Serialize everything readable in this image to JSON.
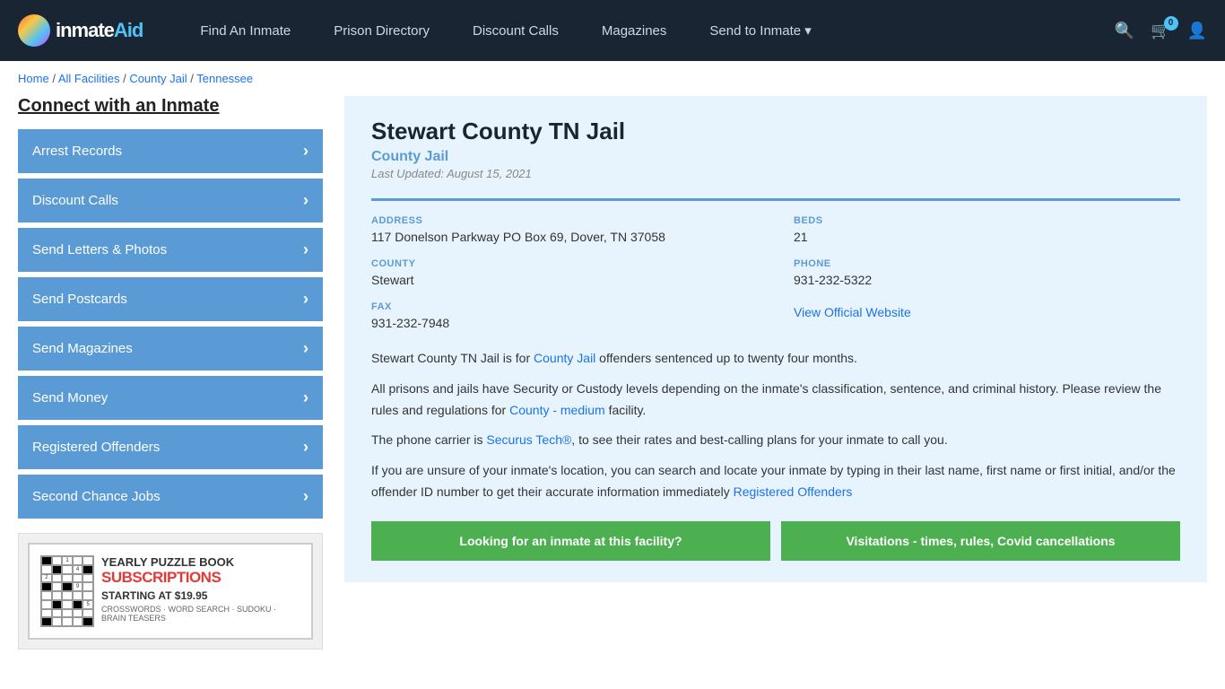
{
  "site": {
    "logo_text": "inmateAid",
    "logo_text_highlight": "Aid"
  },
  "nav": {
    "find_inmate": "Find An Inmate",
    "prison_directory": "Prison Directory",
    "discount_calls": "Discount Calls",
    "magazines": "Magazines",
    "send_to_inmate": "Send to Inmate ▾",
    "cart_count": "0"
  },
  "breadcrumb": {
    "home": "Home",
    "all_facilities": "All Facilities",
    "county_jail": "County Jail",
    "state": "Tennessee"
  },
  "sidebar": {
    "title": "Connect with an Inmate",
    "items": [
      {
        "label": "Arrest Records"
      },
      {
        "label": "Discount Calls"
      },
      {
        "label": "Send Letters & Photos"
      },
      {
        "label": "Send Postcards"
      },
      {
        "label": "Send Magazines"
      },
      {
        "label": "Send Money"
      },
      {
        "label": "Registered Offenders"
      },
      {
        "label": "Second Chance Jobs"
      }
    ]
  },
  "ad": {
    "line1": "YEARLY PUZZLE BOOK",
    "line2": "SUBSCRIPTIONS",
    "price": "STARTING AT $19.95",
    "types": "CROSSWORDS · WORD SEARCH · SUDOKU · BRAIN TEASERS"
  },
  "facility": {
    "name": "Stewart County TN Jail",
    "type": "County Jail",
    "last_updated": "Last Updated: August 15, 2021",
    "address_label": "ADDRESS",
    "address_value": "117 Donelson Parkway PO Box 69, Dover, TN 37058",
    "beds_label": "BEDS",
    "beds_value": "21",
    "county_label": "COUNTY",
    "county_value": "Stewart",
    "phone_label": "PHONE",
    "phone_value": "931-232-5322",
    "fax_label": "FAX",
    "fax_value": "931-232-7948",
    "website_label": "View Official Website",
    "desc1": "Stewart County TN Jail is for County Jail offenders sentenced up to twenty four months.",
    "desc2": "All prisons and jails have Security or Custody levels depending on the inmate's classification, sentence, and criminal history. Please review the rules and regulations for County - medium facility.",
    "desc3": "The phone carrier is Securus Tech®, to see their rates and best-calling plans for your inmate to call you.",
    "desc4": "If you are unsure of your inmate's location, you can search and locate your inmate by typing in their last name, first name or first initial, and/or the offender ID number to get their accurate information immediately Registered Offenders",
    "btn_looking": "Looking for an inmate at this facility?",
    "btn_visitations": "Visitations - times, rules, Covid cancellations"
  }
}
